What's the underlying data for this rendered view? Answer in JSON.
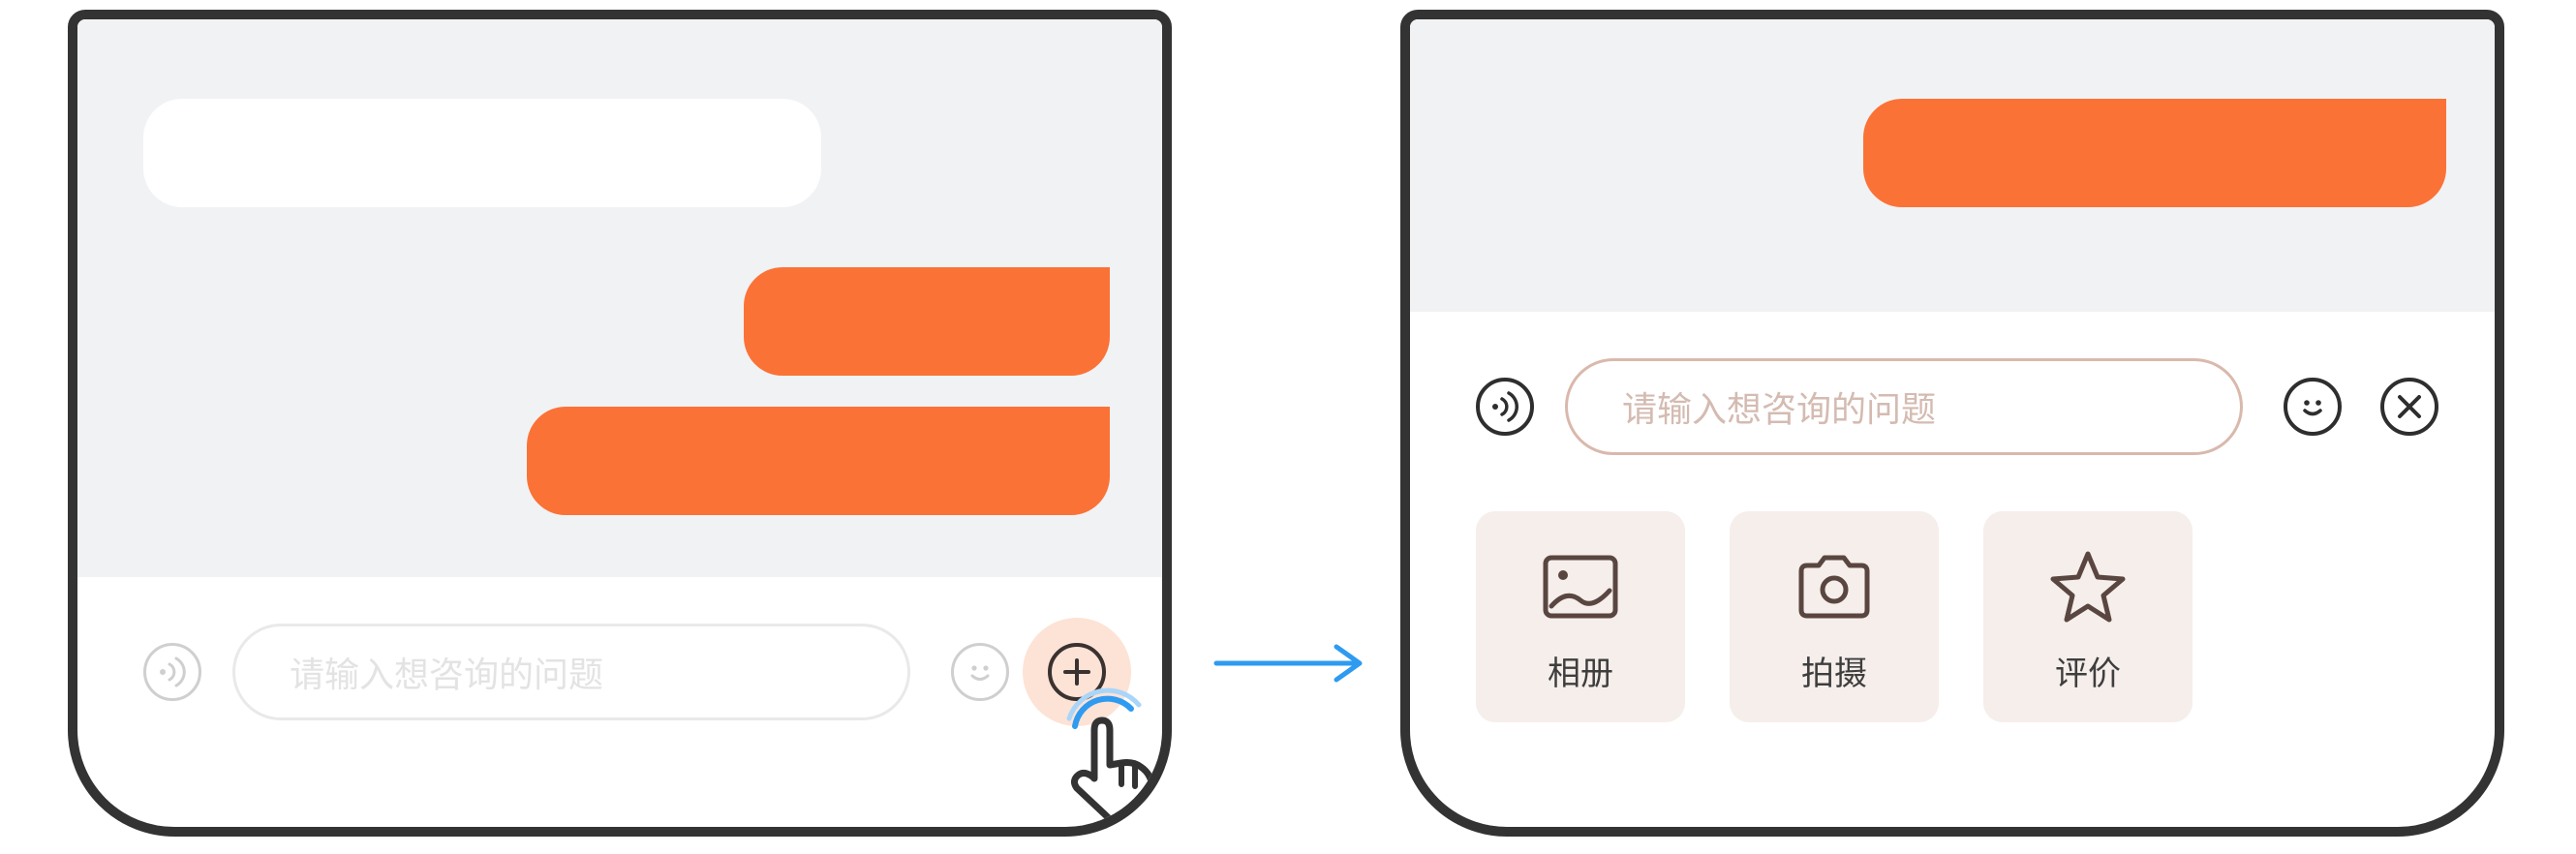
{
  "before": {
    "input_placeholder": "请输入想咨询的问题",
    "icons": [
      "voice-icon",
      "emoji-icon",
      "plus-icon",
      "tap-hand-icon"
    ]
  },
  "after": {
    "input_placeholder": "请输入想咨询的问题",
    "icons": [
      "voice-icon",
      "emoji-icon",
      "close-icon"
    ],
    "functions": [
      {
        "label": "相册",
        "icon": "image-icon"
      },
      {
        "label": "拍摄",
        "icon": "camera-icon"
      },
      {
        "label": "评价",
        "icon": "star-icon"
      }
    ]
  },
  "colors": {
    "accent": "#fb7236",
    "chat_background": "#f1f2f4",
    "tile_background": "#f5eeeb",
    "frame": "#333333",
    "tap_ripple": "#2e9bf0",
    "flow_arrow": "#2e9bf0"
  }
}
